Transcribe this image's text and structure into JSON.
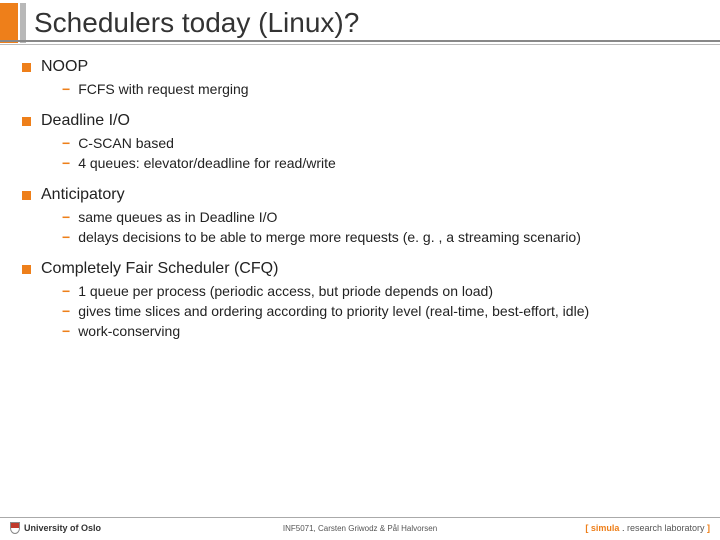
{
  "title": "Schedulers today (Linux)?",
  "sections": [
    {
      "heading": "NOOP",
      "items": [
        "FCFS with request merging"
      ]
    },
    {
      "heading": "Deadline I/O",
      "items": [
        "C-SCAN based",
        "4 queues: elevator/deadline for read/write"
      ]
    },
    {
      "heading": "Anticipatory",
      "items": [
        "same queues as in Deadline I/O",
        "delays decisions to be able to merge more requests (e. g. , a streaming scenario)"
      ]
    },
    {
      "heading": "Completely Fair Scheduler (CFQ)",
      "items": [
        "1 queue per process (periodic access, but priode depends on load)",
        "gives time slices and ordering according to priority level (real-time, best-effort, idle)",
        "work-conserving"
      ]
    }
  ],
  "footer": {
    "left": "University of Oslo",
    "center": "INF5071, Carsten Griwodz & Pål Halvorsen",
    "right_bracket_open": "[ ",
    "right_brand": "simula",
    "right_dot": " . ",
    "right_lab": "research laboratory",
    "right_bracket_close": " ]"
  }
}
